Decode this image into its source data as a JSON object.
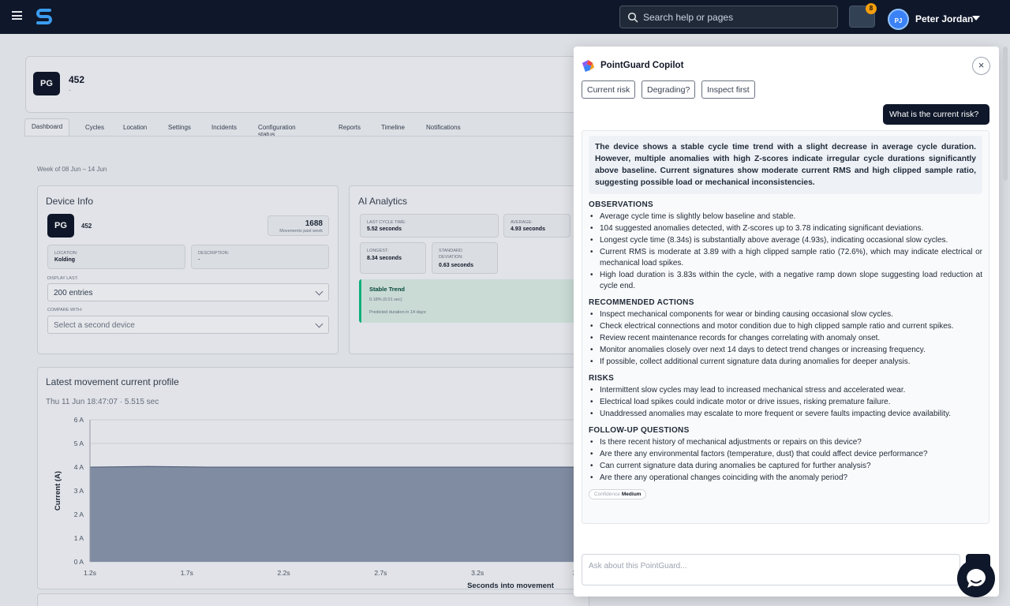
{
  "topbar": {
    "search_placeholder": "Search help or pages",
    "notification_count": "8",
    "user_initials": "PJ",
    "user_name": "Peter Jordan"
  },
  "device": {
    "badge": "PG",
    "id": "452",
    "sub": "-"
  },
  "tabs": [
    "Dashboard",
    "Cycles",
    "Location",
    "Settings",
    "Incidents",
    "Configuration status",
    "Reports",
    "Timeline",
    "Notifications"
  ],
  "week_label": "Week of 08 Jun – 14 Jun",
  "device_info": {
    "title": "Device Info",
    "badge": "PG",
    "id": "452",
    "movements": "1688",
    "movements_label": "Movements past week",
    "location_label": "LOCATION:",
    "location": "Kolding",
    "description_label": "DESCRIPTION:",
    "description": "-",
    "display_last_label": "DISPLAY LAST:",
    "display_last": "200 entries",
    "compare_label": "COMPARE WITH:",
    "compare_placeholder": "Select a second device"
  },
  "ai_analytics": {
    "title": "AI Analytics",
    "last_cycle_label": "LAST CYCLE TIME:",
    "last_cycle": "5.52 seconds",
    "average_label": "AVERAGE:",
    "average": "4.93 seconds",
    "longest_label": "LONGEST:",
    "longest": "8.34 seconds",
    "std_label": "STANDARD DEVIATION:",
    "std": "0.63 seconds",
    "trend_title": "Stable Trend",
    "trend_change": "0.18% (0.01 sec)",
    "trend_predicted": "Predicted duration in 14 days:"
  },
  "profile": {
    "title": "Latest movement current profile",
    "subtitle": "Thu 11 Jun 18:47:07 · 5.515 sec"
  },
  "chart_data": {
    "type": "area",
    "title": "",
    "xlabel": "Seconds into movement",
    "ylabel": "Current (A)",
    "x": [
      1.2,
      1.5,
      1.8,
      2.1,
      2.4,
      2.7,
      3.0,
      3.25
    ],
    "values": [
      4.0,
      4.03,
      4.0,
      4.0,
      4.0,
      4.0,
      4.0,
      4.0
    ],
    "xticks": [
      "1.2s",
      "1.7s",
      "2.2s",
      "2.7s",
      "3.2s",
      "3"
    ],
    "yticks": [
      "0 A",
      "1 A",
      "2 A",
      "3 A",
      "4 A",
      "5 A",
      "6 A"
    ],
    "ylim": [
      0,
      6
    ],
    "xlim": [
      1.2,
      3.7
    ],
    "color": "#8794ab",
    "grid": true
  },
  "copilot": {
    "title": "PointGuard Copilot",
    "chips": [
      "Current risk",
      "Degrading?",
      "Inspect first"
    ],
    "user_message": "What is the current risk?",
    "summary": "The device shows a stable cycle time trend with a slight decrease in average cycle duration. However, multiple anomalies with high Z-scores indicate irregular cycle durations significantly above baseline. Current signatures show moderate current RMS and high clipped sample ratio, suggesting possible load or mechanical inconsistencies.",
    "sections": [
      {
        "heading": "OBSERVATIONS",
        "items": [
          "Average cycle time is slightly below baseline and stable.",
          "104 suggested anomalies detected, with Z-scores up to 3.78 indicating significant deviations.",
          "Longest cycle time (8.34s) is substantially above average (4.93s), indicating occasional slow cycles.",
          "Current RMS is moderate at 3.89 with a high clipped sample ratio (72.6%), which may indicate electrical or mechanical load spikes.",
          "High load duration is 3.83s within the cycle, with a negative ramp down slope suggesting load reduction at cycle end."
        ]
      },
      {
        "heading": "RECOMMENDED ACTIONS",
        "items": [
          "Inspect mechanical components for wear or binding causing occasional slow cycles.",
          "Check electrical connections and motor condition due to high clipped sample ratio and current spikes.",
          "Review recent maintenance records for changes correlating with anomaly onset.",
          "Monitor anomalies closely over next 14 days to detect trend changes or increasing frequency.",
          "If possible, collect additional current signature data during anomalies for deeper analysis."
        ]
      },
      {
        "heading": "RISKS",
        "items": [
          "Intermittent slow cycles may lead to increased mechanical stress and accelerated wear.",
          "Electrical load spikes could indicate motor or drive issues, risking premature failure.",
          "Unaddressed anomalies may escalate to more frequent or severe faults impacting device availability."
        ]
      },
      {
        "heading": "FOLLOW-UP QUESTIONS",
        "items": [
          "Is there recent history of mechanical adjustments or repairs on this device?",
          "Are there any environmental factors (temperature, dust) that could affect device performance?",
          "Can current signature data during anomalies be captured for further analysis?",
          "Are there any operational changes coinciding with the anomaly period?"
        ]
      }
    ],
    "confidence_label": "Confidence",
    "confidence_value": "Medium",
    "input_placeholder": "Ask about this PointGuard..."
  }
}
